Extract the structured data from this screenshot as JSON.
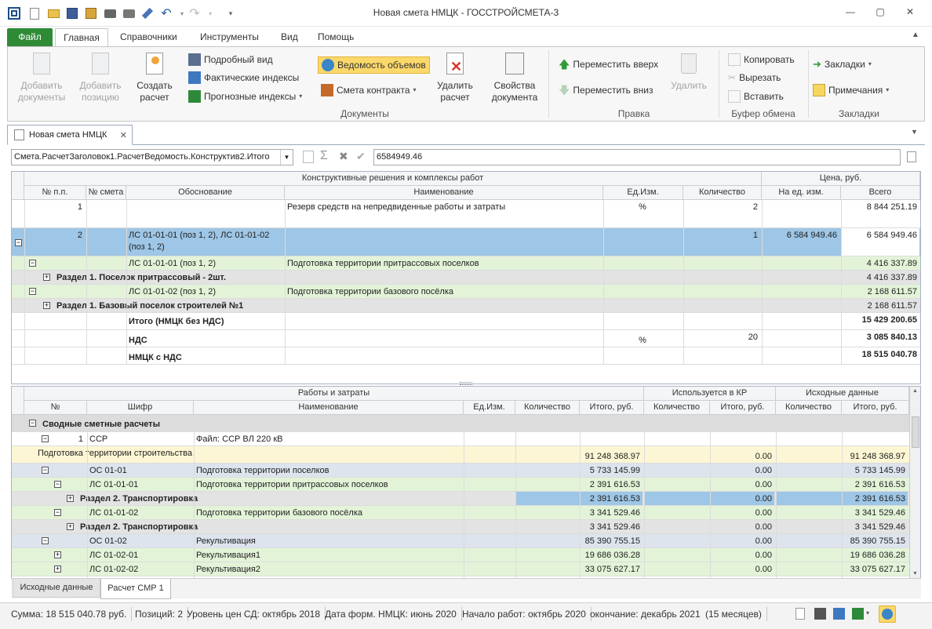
{
  "window": {
    "title": "Новая смета НМЦК - ГОССТРОЙСМЕТА-3"
  },
  "menu": {
    "file": "Файл",
    "tabs": [
      "Главная",
      "Справочники",
      "Инструменты",
      "Вид",
      "Помощь"
    ]
  },
  "ribbon": {
    "add_doc": "Добавить документы",
    "add_pos": "Добавить позицию",
    "create_calc": "Создать расчет",
    "detail_view": "Подробный вид",
    "actual_idx": "Фактические индексы",
    "forecast_idx": "Прогнозные индексы",
    "volume_sheet": "Ведомость объемов",
    "contract_est": "Смета контракта",
    "delete_calc": "Удалить расчет",
    "doc_props": "Свойства документа",
    "group_docs": "Документы",
    "move_up": "Переместить вверх",
    "move_down": "Переместить вниз",
    "delete": "Удалить",
    "group_edit": "Правка",
    "copy": "Копировать",
    "cut": "Вырезать",
    "paste": "Вставить",
    "group_clip": "Буфер обмена",
    "bookmarks": "Закладки",
    "notes": "Примечания",
    "group_bm": "Закладки"
  },
  "doc_tab": "Новая смета НМЦК",
  "path": {
    "value": "Смета.РасчетЗаголовок1.РасчетВедомость.Конструктив2.Итого",
    "formula": "6584949.46"
  },
  "top_grid": {
    "group1": "Конструктивные решения и комплексы работ",
    "group2": "Цена, руб.",
    "headers": [
      "№ п.п.",
      "№ смета",
      "Обоснование",
      "Наименование",
      "Ед.Изм.",
      "Количество",
      "На ед. изм.",
      "Всего"
    ],
    "rows": [
      {
        "n": "1",
        "sm": "",
        "ob": "",
        "name": "Резерв средств на непредвиденные работы и затраты",
        "unit": "%",
        "qty": "2",
        "price": "",
        "total": "8 844 251.19"
      },
      {
        "n": "2",
        "sm": "",
        "ob": "ЛС 01-01-01 (поз 1, 2), ЛС 01-01-02 (поз 1, 2)",
        "name": "",
        "unit": "",
        "qty": "1",
        "price": "6 584 949.46",
        "total": "6 584 949.46"
      },
      {
        "ob": "ЛС 01-01-01 (поз 1, 2)",
        "name": "Подготовка территории притрассовых поселков",
        "total": "4 416 337.89"
      },
      {
        "label": "Раздел 1. Поселок притрассовый - 2шт.",
        "total": "4 416 337.89"
      },
      {
        "ob": "ЛС 01-01-02 (поз 1, 2)",
        "name": "Подготовка территории базового посёлка",
        "total": "2 168 611.57"
      },
      {
        "label": "Раздел 1. Базовый поселок строителей №1",
        "total": "2 168 611.57"
      },
      {
        "ob": "Итого (НМЦК без НДС)",
        "total": "15 429 200.65"
      },
      {
        "ob": "НДС",
        "unit": "%",
        "qty": "20",
        "total": "3 085 840.13"
      },
      {
        "ob": "НМЦК с НДС",
        "total": "18 515 040.78"
      }
    ]
  },
  "bottom_grid": {
    "group1": "Работы и затраты",
    "group2": "Используется в КР",
    "group3": "Исходные данные",
    "headers": [
      "№",
      "Шифр",
      "Наименование",
      "Ед.Изм.",
      "Количество",
      "Итого, руб.",
      "Количество",
      "Итого, руб.",
      "Количество",
      "Итого, руб."
    ],
    "group_row": "Сводные сметные расчеты",
    "rows": [
      {
        "n": "1",
        "code": "ССР",
        "name": "Файл: ССР ВЛ 220 кВ",
        "total": "",
        "kr": "",
        "src": ""
      },
      {
        "full": "Подготовка территории строительства",
        "total": "91 248 368.97",
        "kr": "0.00",
        "src": "91 248 368.97"
      },
      {
        "code": "ОС 01-01",
        "name": "Подготовка территории поселков",
        "total": "5 733 145.99",
        "kr": "0.00",
        "src": "5 733 145.99"
      },
      {
        "code": "ЛС 01-01-01",
        "name": "Подготовка территории притрассовых поселков",
        "total": "2 391 616.53",
        "kr": "0.00",
        "src": "2 391 616.53"
      },
      {
        "label": "Раздел 2. Транспортировка",
        "total": "2 391 616.53",
        "kr": "0.00",
        "src": "2 391 616.53"
      },
      {
        "code": "ЛС 01-01-02",
        "name": "Подготовка территории базового посёлка",
        "total": "3 341 529.46",
        "kr": "0.00",
        "src": "3 341 529.46"
      },
      {
        "label": "Раздел 2. Транспортировка",
        "total": "3 341 529.46",
        "kr": "0.00",
        "src": "3 341 529.46"
      },
      {
        "code": "ОС 01-02",
        "name": "Рекультивация",
        "total": "85 390 755.15",
        "kr": "0.00",
        "src": "85 390 755.15"
      },
      {
        "code": "ЛС 01-02-01",
        "name": "Рекультивация1",
        "total": "19 686 036.28",
        "kr": "0.00",
        "src": "19 686 036.28"
      },
      {
        "code": "ЛС 01-02-02",
        "name": "Рекультивация2",
        "total": "33 075 627.17",
        "kr": "0.00",
        "src": "33 075 627.17"
      }
    ]
  },
  "sheet_tabs": [
    "Исходные данные",
    "Расчет СМР 1"
  ],
  "status": {
    "sum": "Сумма: 18 515 040.78 руб.",
    "pos": "Позиций:   2",
    "level": "Уровень цен СД: октябрь 2018",
    "date": "Дата форм. НМЦК: июнь 2020",
    "start": "Начало работ: октябрь 2020",
    "end": "окончание: декабрь 2021",
    "months": "(15 месяцев)"
  }
}
